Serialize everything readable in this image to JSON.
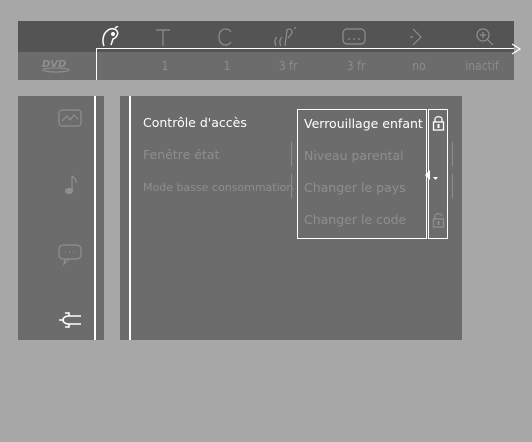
{
  "top_icons": [
    {
      "name": "pointer-icon",
      "active": true
    },
    {
      "name": "title-icon"
    },
    {
      "name": "chapter-icon"
    },
    {
      "name": "audio-icon"
    },
    {
      "name": "subtitle-icon"
    },
    {
      "name": "angle-icon"
    },
    {
      "name": "zoom-icon"
    }
  ],
  "values": {
    "title": "1",
    "chapter": "1",
    "audio": "3 fr",
    "subtitle": "3 fr",
    "angle": "no",
    "zoom": "inactif"
  },
  "left_menu": [
    {
      "name": "picture-settings-icon"
    },
    {
      "name": "sound-settings-icon"
    },
    {
      "name": "language-settings-icon"
    },
    {
      "name": "features-icon",
      "active": true
    }
  ],
  "menu_items": {
    "access_control": "Contrôle d'accès",
    "status_window": "Fenêtre état",
    "low_power_mode": "Mode basse consommation"
  },
  "submenu": {
    "child_lock": "Verrouillage enfant",
    "parental_level": "Niveau parental",
    "change_country": "Changer le pays",
    "change_code": "Changer le code"
  },
  "colors": {
    "background": "#a7a7a7",
    "panel": "#6c6c6c",
    "topbar": "#545454",
    "highlight": "#ffffff",
    "dim": "#8e8e8e"
  }
}
